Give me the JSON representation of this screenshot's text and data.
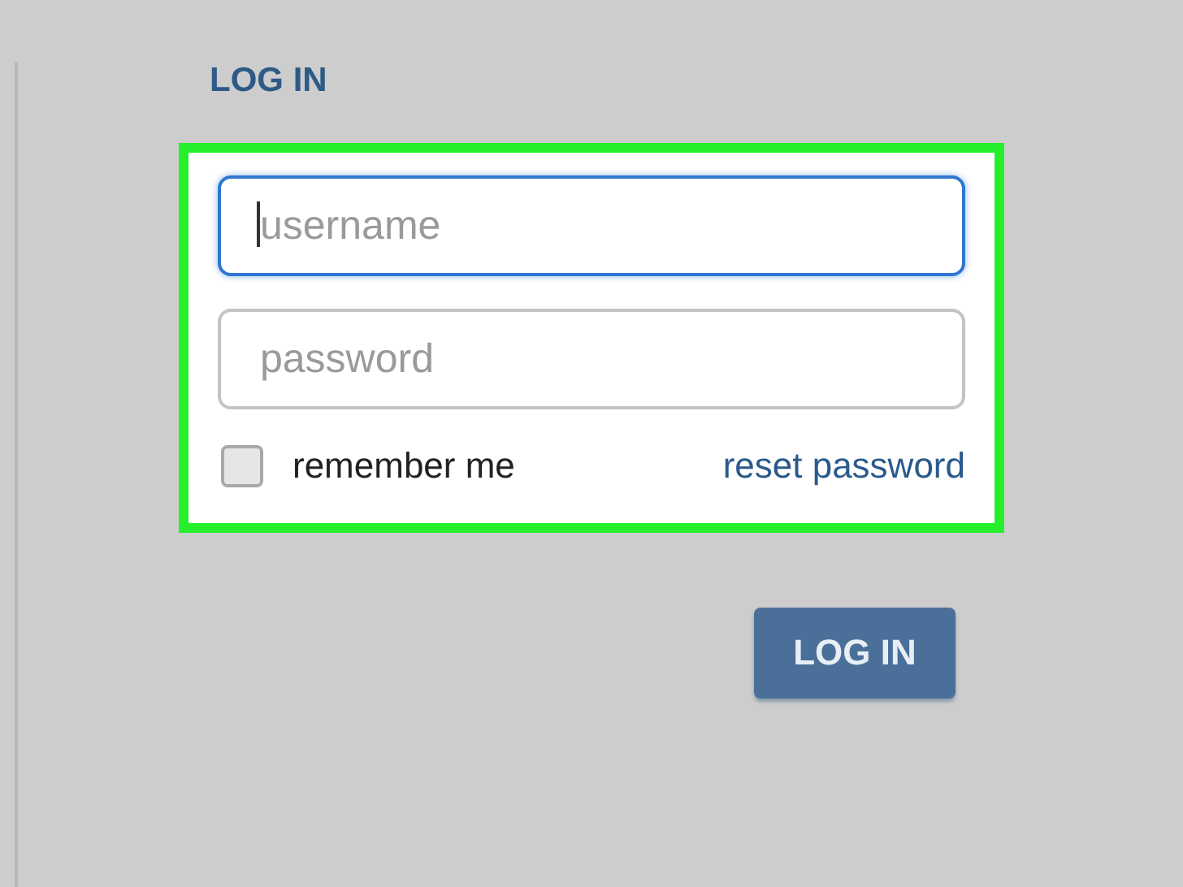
{
  "heading": "LOG IN",
  "fields": [
    {
      "placeholder": "username",
      "focused": true
    },
    {
      "placeholder": "password",
      "focused": false
    }
  ],
  "remember": {
    "label": "remember me",
    "checked": false
  },
  "reset_link": "reset password",
  "highlighted": true,
  "button": "LOG IN"
}
